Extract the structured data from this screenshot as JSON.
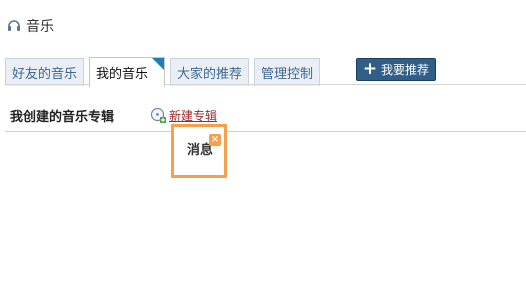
{
  "header": {
    "title": "音乐",
    "icon": "headphones-icon"
  },
  "tabs": [
    {
      "label": "好友的音乐"
    },
    {
      "label": "我的音乐",
      "active": true
    },
    {
      "label": "大家的推荐"
    },
    {
      "label": "管理控制"
    }
  ],
  "recommend_button": {
    "label": "我要推荐",
    "icon": "plus-icon"
  },
  "section": {
    "title": "我创建的音乐专辑",
    "new_album_label": "新建专辑",
    "new_album_icon": "add-album-icon"
  },
  "tooltip": {
    "text": "消息",
    "close_icon": "close-icon"
  },
  "colors": {
    "tab_link": "#3f6790",
    "button_bg": "#2f5f87",
    "tooltip_border": "#f5a04a",
    "new_album_link": "#9c2a2a"
  }
}
